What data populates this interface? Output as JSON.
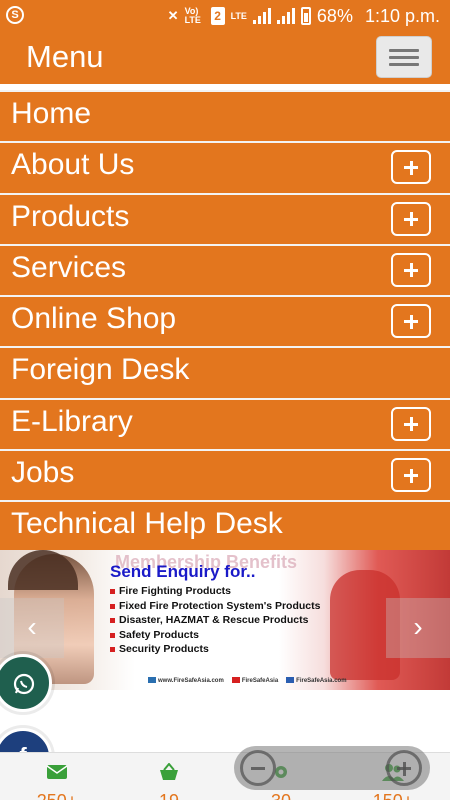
{
  "status_bar": {
    "notification_icon": "S",
    "mute_icon": "mute-icon",
    "volte": "Vo) LTE",
    "sim": "2",
    "lte": "LTE",
    "battery": "68%",
    "time": "1:10 p.m."
  },
  "menu": {
    "title": "Menu",
    "items": [
      {
        "label": "Home",
        "expandable": false
      },
      {
        "label": "About Us",
        "expandable": true
      },
      {
        "label": "Products",
        "expandable": true
      },
      {
        "label": "Services",
        "expandable": true
      },
      {
        "label": "Online Shop",
        "expandable": true
      },
      {
        "label": "Foreign Desk",
        "expandable": false
      },
      {
        "label": "E-Library",
        "expandable": true
      },
      {
        "label": "Jobs",
        "expandable": true
      },
      {
        "label": "Technical Help Desk",
        "expandable": false
      }
    ]
  },
  "banner": {
    "ghost_heading": "Membership Benefits",
    "title": "Send Enquiry for..",
    "items": [
      "Fire Fighting Products",
      "Fixed Fire Protection System's Products",
      "Disaster, HAZMAT & Rescue Products",
      "Safety Products",
      "Security Products"
    ],
    "footer": [
      "www.FireSafeAsia.com",
      "FireSafeAsia",
      "FireSafeAsia.com"
    ],
    "prev_arrow": "‹",
    "next_arrow": "›"
  },
  "social": {
    "whatsapp_icon": "whatsapp-icon",
    "facebook_icon": "f"
  },
  "stats": [
    {
      "icon": "envelope-icon",
      "value": "250+"
    },
    {
      "icon": "basket-icon",
      "value": "19"
    },
    {
      "icon": "gear-icon",
      "value": "30"
    },
    {
      "icon": "users-icon",
      "value": "150+"
    }
  ],
  "colors": {
    "accent": "#e3761e",
    "banner_title": "#1a1ac8",
    "whatsapp": "#1f5f4e",
    "facebook": "#1d3f7d",
    "stat_icon": "#3aa03a"
  }
}
